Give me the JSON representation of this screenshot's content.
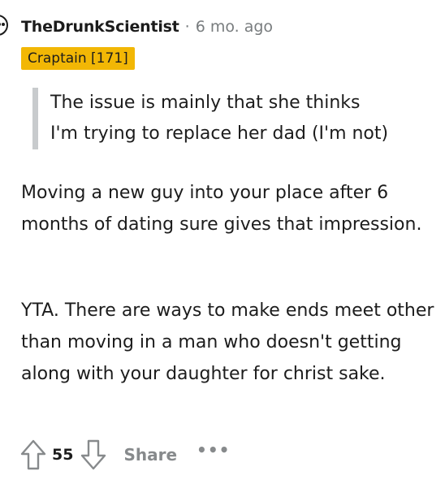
{
  "comment": {
    "author": "TheDrunkScientist",
    "separator": "·",
    "time": "6 mo. ago",
    "flair": "Craptain [171]",
    "flair_color": "#f2b705",
    "quote_lines": [
      "The issue is mainly that she thinks",
      "I'm trying to replace her dad (I'm not)"
    ],
    "paragraphs": [
      "Moving a new guy into your place after 6 months of dating sure gives that impression.",
      "YTA. There are ways to make ends meet other than moving in a man who doesn't getting along with your daughter for christ sake."
    ]
  },
  "footer": {
    "upvote_icon": "upvote-arrow-icon",
    "score": "55",
    "downvote_icon": "downvote-arrow-icon",
    "share_label": "Share",
    "more_label": "•••"
  }
}
